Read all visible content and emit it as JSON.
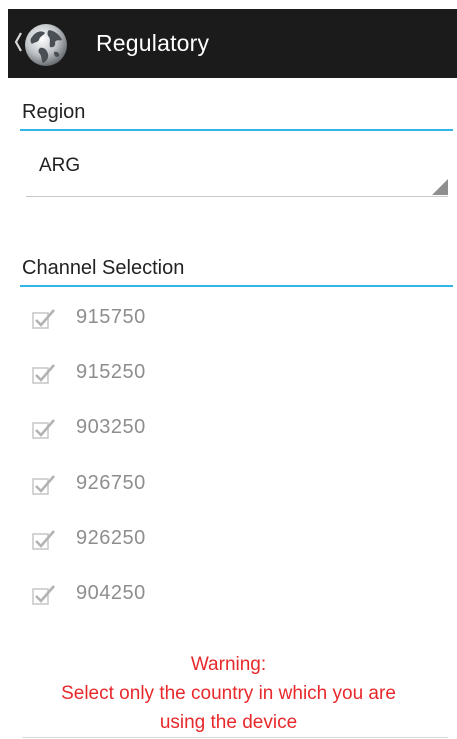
{
  "action_bar": {
    "title": "Regulatory",
    "background": "#1b1b1b"
  },
  "region": {
    "header": "Region",
    "selected": "ARG"
  },
  "channel_selection": {
    "header": "Channel Selection",
    "channels": [
      {
        "value": "915750",
        "checked": true,
        "enabled": false
      },
      {
        "value": "915250",
        "checked": true,
        "enabled": false
      },
      {
        "value": "903250",
        "checked": true,
        "enabled": false
      },
      {
        "value": "926750",
        "checked": true,
        "enabled": false
      },
      {
        "value": "926250",
        "checked": true,
        "enabled": false
      },
      {
        "value": "904250",
        "checked": true,
        "enabled": false
      }
    ]
  },
  "warning": {
    "line1": "Warning:",
    "line2": "Select only the country in which you are",
    "line3": "using the device"
  },
  "colors": {
    "accent": "#33b5e5",
    "warning": "#e8292b",
    "disabled_text": "#8e8e8e"
  }
}
